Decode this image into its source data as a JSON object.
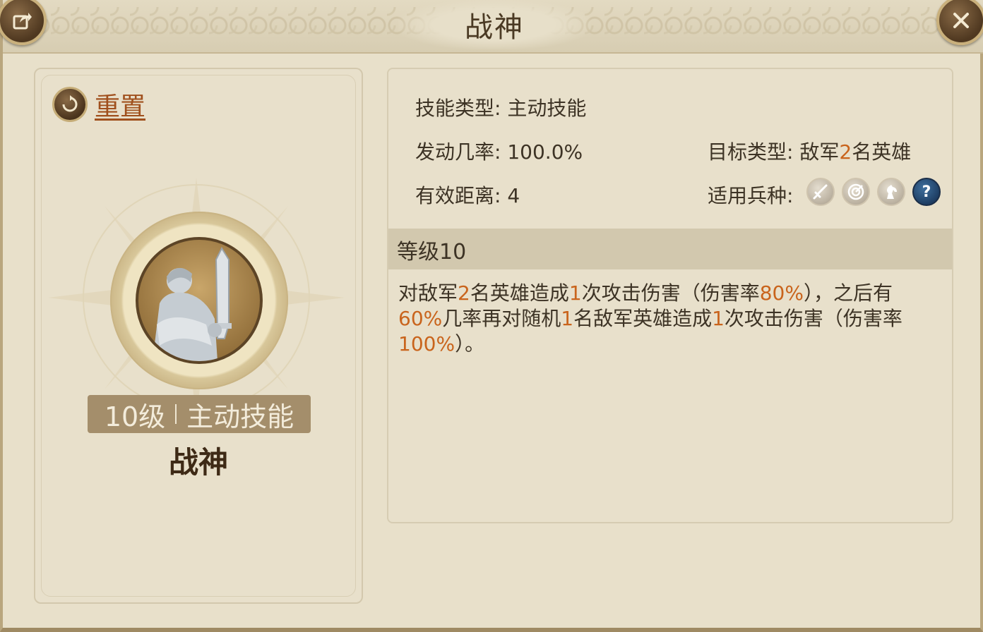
{
  "title": "战神",
  "reset_label": "重置",
  "skill_card": {
    "level": "10级",
    "type": "主动技能",
    "name": "战神"
  },
  "details": {
    "skill_type_label": "技能类型:",
    "skill_type_value": "主动技能",
    "trigger_rate_label": "发动几率:",
    "trigger_rate_value": "100.0%",
    "range_label": "有效距离:",
    "range_value": "4",
    "target_label": "目标类型:",
    "target_prefix": "敌军",
    "target_count": "2",
    "target_suffix": "名英雄",
    "troop_label": "适用兵种:",
    "troop_icons": [
      "sword-icon",
      "target-icon",
      "horse-icon",
      "question-icon"
    ]
  },
  "level_header": "等级10",
  "description": {
    "p1": "对敌军",
    "n1": "2",
    "p2": "名英雄造成",
    "n2": "1",
    "p3": "次攻击伤害（伤害率",
    "n3": "80%",
    "p4": "），之后有",
    "n4": "60%",
    "p5": "几率再对随机",
    "n5": "1",
    "p6": "名敌军英雄造成",
    "n6": "1",
    "p7": "次攻击伤害（伤害率",
    "n7": "100%",
    "p8": "）。"
  },
  "colors": {
    "highlight": "#c9641c",
    "text": "#3d3325",
    "panel": "#e8e0cb"
  }
}
